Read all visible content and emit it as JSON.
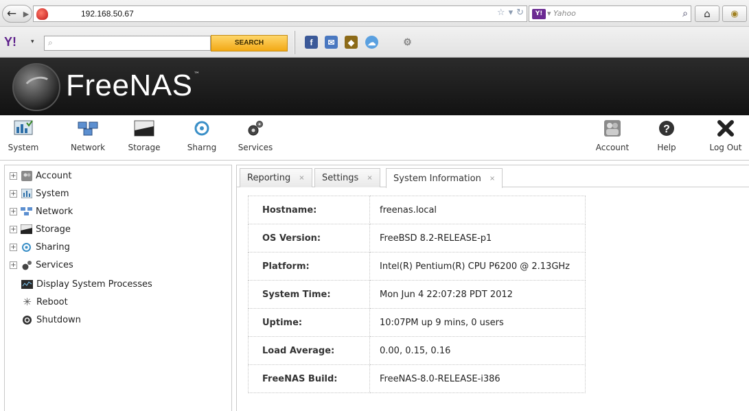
{
  "browser": {
    "url": "192.168.50.67",
    "search_provider": "Yahoo",
    "back_label": "back",
    "forward_label": "forward"
  },
  "yahoo_toolbar": {
    "logo": "Y!",
    "search_button": "SEARCH",
    "search_value": ""
  },
  "header": {
    "title": "FreeNAS",
    "trademark": "™"
  },
  "toolbar": {
    "items": [
      {
        "label": "System",
        "icon": "system-icon"
      },
      {
        "label": "Network",
        "icon": "network-icon"
      },
      {
        "label": "Storage",
        "icon": "storage-icon"
      },
      {
        "label": "Sharng",
        "icon": "sharing-icon"
      },
      {
        "label": "Services",
        "icon": "services-icon"
      }
    ],
    "right_items": [
      {
        "label": "Account",
        "icon": "account-icon"
      },
      {
        "label": "Help",
        "icon": "help-icon"
      },
      {
        "label": "Log Out",
        "icon": "logout-icon"
      }
    ]
  },
  "sidebar": {
    "items": [
      {
        "label": "Account",
        "expandable": true
      },
      {
        "label": "System",
        "expandable": true
      },
      {
        "label": "Network",
        "expandable": true
      },
      {
        "label": "Storage",
        "expandable": true
      },
      {
        "label": "Sharing",
        "expandable": true
      },
      {
        "label": "Services",
        "expandable": true
      },
      {
        "label": "Display System Processes",
        "expandable": false
      },
      {
        "label": "Reboot",
        "expandable": false
      },
      {
        "label": "Shutdown",
        "expandable": false
      }
    ]
  },
  "tabs": [
    {
      "label": "Reporting",
      "close": "×"
    },
    {
      "label": "Settings",
      "close": "×"
    },
    {
      "label": "System Information",
      "close": "×",
      "active": true
    }
  ],
  "system_info": {
    "rows": [
      {
        "label": "Hostname:",
        "value": "freenas.local"
      },
      {
        "label": "OS Version:",
        "value": "FreeBSD 8.2-RELEASE-p1"
      },
      {
        "label": "Platform:",
        "value": "Intel(R) Pentium(R) CPU P6200 @ 2.13GHz"
      },
      {
        "label": "System Time:",
        "value": "Mon Jun 4 22:07:28 PDT 2012"
      },
      {
        "label": "Uptime:",
        "value": "10:07PM up 9 mins, 0 users"
      },
      {
        "label": "Load Average:",
        "value": "0.00, 0.15, 0.16"
      },
      {
        "label": "FreeNAS Build:",
        "value": "FreeNAS-8.0-RELEASE-i386"
      }
    ]
  },
  "colors": {
    "header_bg": "#1b1b1b",
    "yahoo_purple": "#5c1e8a",
    "search_button": "#f2a915"
  }
}
